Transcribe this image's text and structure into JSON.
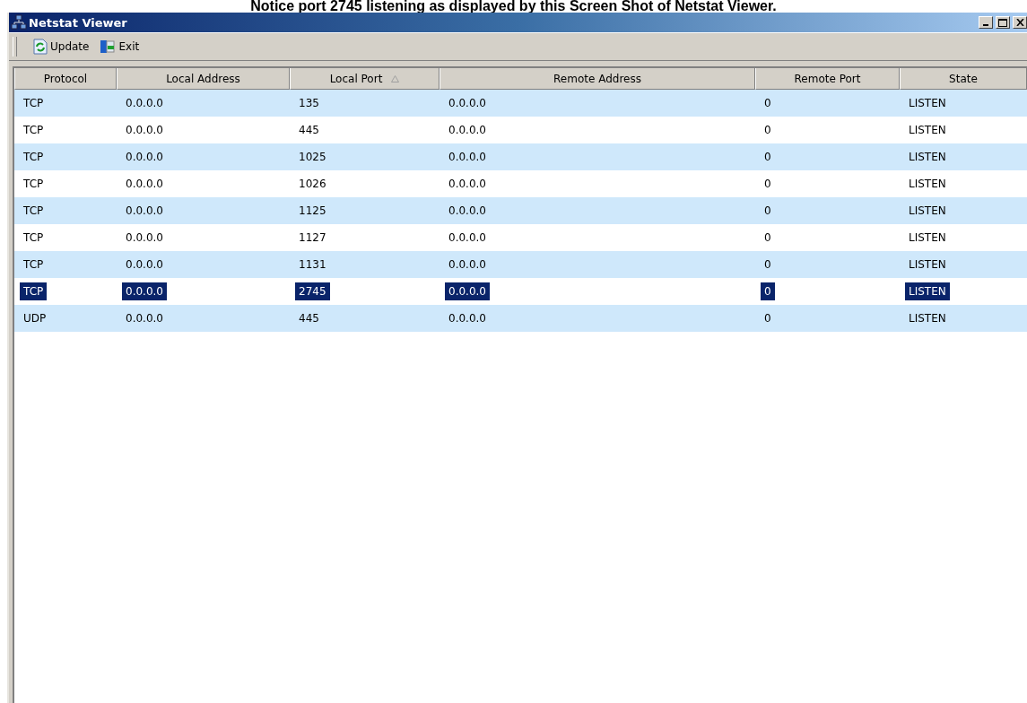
{
  "caption": "Notice port 2745 listening as displayed by this Screen Shot of Netstat Viewer.",
  "window": {
    "title": "Netstat Viewer"
  },
  "toolbar": [
    {
      "label": "Update",
      "kind": "update"
    },
    {
      "label": "Exit",
      "kind": "exit"
    }
  ],
  "table": {
    "columns": [
      {
        "label": "Protocol",
        "sorted": false
      },
      {
        "label": "Local Address",
        "sorted": false
      },
      {
        "label": "Local Port",
        "sorted": true
      },
      {
        "label": "Remote Address",
        "sorted": false
      },
      {
        "label": "Remote Port",
        "sorted": false
      },
      {
        "label": "State",
        "sorted": false
      }
    ],
    "rows": [
      {
        "cells": [
          "TCP",
          "0.0.0.0",
          "135",
          "0.0.0.0",
          "0",
          "LISTEN"
        ],
        "selected": false
      },
      {
        "cells": [
          "TCP",
          "0.0.0.0",
          "445",
          "0.0.0.0",
          "0",
          "LISTEN"
        ],
        "selected": false
      },
      {
        "cells": [
          "TCP",
          "0.0.0.0",
          "1025",
          "0.0.0.0",
          "0",
          "LISTEN"
        ],
        "selected": false
      },
      {
        "cells": [
          "TCP",
          "0.0.0.0",
          "1026",
          "0.0.0.0",
          "0",
          "LISTEN"
        ],
        "selected": false
      },
      {
        "cells": [
          "TCP",
          "0.0.0.0",
          "1125",
          "0.0.0.0",
          "0",
          "LISTEN"
        ],
        "selected": false
      },
      {
        "cells": [
          "TCP",
          "0.0.0.0",
          "1127",
          "0.0.0.0",
          "0",
          "LISTEN"
        ],
        "selected": false
      },
      {
        "cells": [
          "TCP",
          "0.0.0.0",
          "1131",
          "0.0.0.0",
          "0",
          "LISTEN"
        ],
        "selected": false
      },
      {
        "cells": [
          "TCP",
          "0.0.0.0",
          "2745",
          "0.0.0.0",
          "0",
          "LISTEN"
        ],
        "selected": true
      },
      {
        "cells": [
          "UDP",
          "0.0.0.0",
          "445",
          "0.0.0.0",
          "0",
          "LISTEN"
        ],
        "selected": false
      }
    ]
  }
}
